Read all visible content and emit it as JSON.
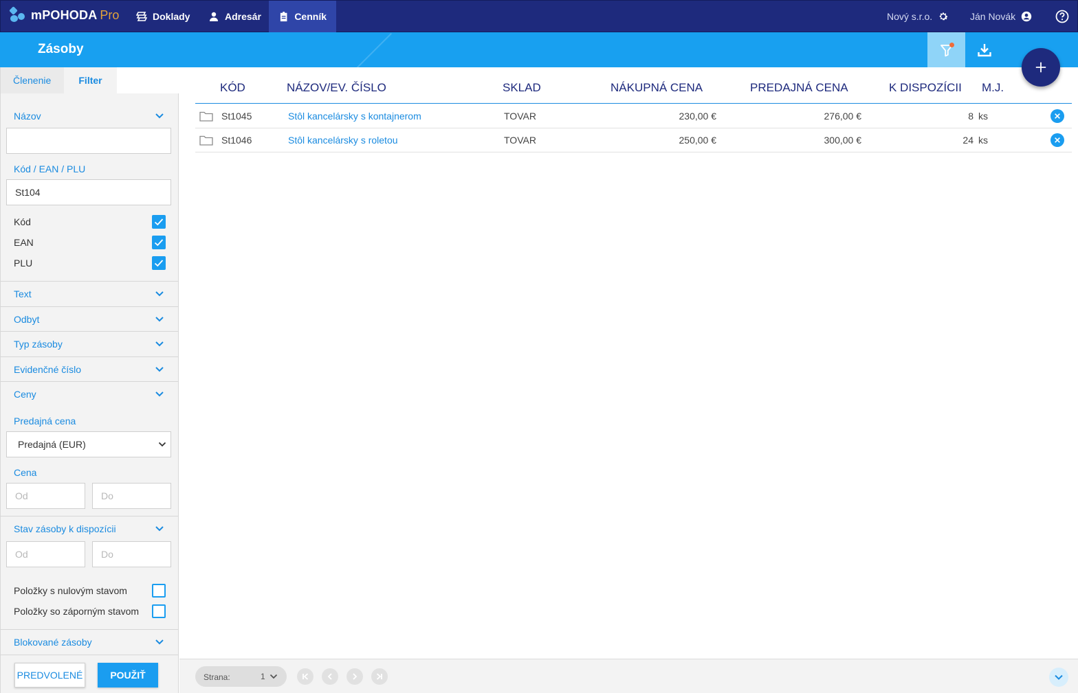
{
  "app": {
    "brand_name": "mPOHODA",
    "brand_suffix": "Pro"
  },
  "topnav": {
    "tabs": [
      {
        "label": "Doklady",
        "icon": "layers-icon"
      },
      {
        "label": "Adresár",
        "icon": "person-icon"
      },
      {
        "label": "Cenník",
        "icon": "clipboard-icon",
        "active": true
      }
    ],
    "company": "Nový s.r.o.",
    "user": "Ján Novák"
  },
  "subheader": {
    "title": "Zásoby"
  },
  "sidebar": {
    "tabs": [
      {
        "label": "Členenie"
      },
      {
        "label": "Filter",
        "active": true
      }
    ],
    "name_section": {
      "label": "Názov",
      "value": ""
    },
    "code_section": {
      "label": "Kód / EAN / PLU",
      "value": "St104",
      "checkboxes": [
        {
          "label": "Kód",
          "checked": true
        },
        {
          "label": "EAN",
          "checked": true
        },
        {
          "label": "PLU",
          "checked": true
        }
      ]
    },
    "collapsed_sections": [
      "Text",
      "Odbyt",
      "Typ zásoby",
      "Evidenčné číslo"
    ],
    "prices_section": {
      "label": "Ceny",
      "price_type_label": "Predajná cena",
      "price_type_value": "Predajná (EUR)",
      "price_label": "Cena",
      "from_placeholder": "Od",
      "to_placeholder": "Do"
    },
    "stock_section": {
      "label": "Stav zásoby k dispozícii",
      "from_placeholder": "Od",
      "to_placeholder": "Do",
      "checkboxes": [
        {
          "label": "Položky s nulovým stavom",
          "checked": false
        },
        {
          "label": "Položky so záporným stavom",
          "checked": false
        }
      ]
    },
    "blocked_section": {
      "label": "Blokované zásoby"
    },
    "buttons": {
      "default_label": "PREDVOLENÉ",
      "apply_label": "POUŽIŤ"
    }
  },
  "table": {
    "columns": [
      "KÓD",
      "NÁZOV/EV. ČÍSLO",
      "SKLAD",
      "NÁKUPNÁ CENA",
      "PREDAJNÁ CENA",
      "K DISPOZÍCII",
      "M.J."
    ],
    "rows": [
      {
        "code": "St1045",
        "name": "Stôl kancelársky s kontajnerom",
        "warehouse": "TOVAR",
        "purchase_price": "230,00 €",
        "sale_price": "276,00 €",
        "available": "8",
        "unit": "ks"
      },
      {
        "code": "St1046",
        "name": "Stôl kancelársky s roletou",
        "warehouse": "TOVAR",
        "purchase_price": "250,00 €",
        "sale_price": "300,00 €",
        "available": "24",
        "unit": "ks"
      }
    ]
  },
  "pagination": {
    "page_label": "Strana:",
    "page_value": "1"
  },
  "colors": {
    "navy": "#1e2a7d",
    "accent_blue": "#18a0f0",
    "link_blue": "#1a8be0",
    "brand_orange": "#e3a33a"
  }
}
